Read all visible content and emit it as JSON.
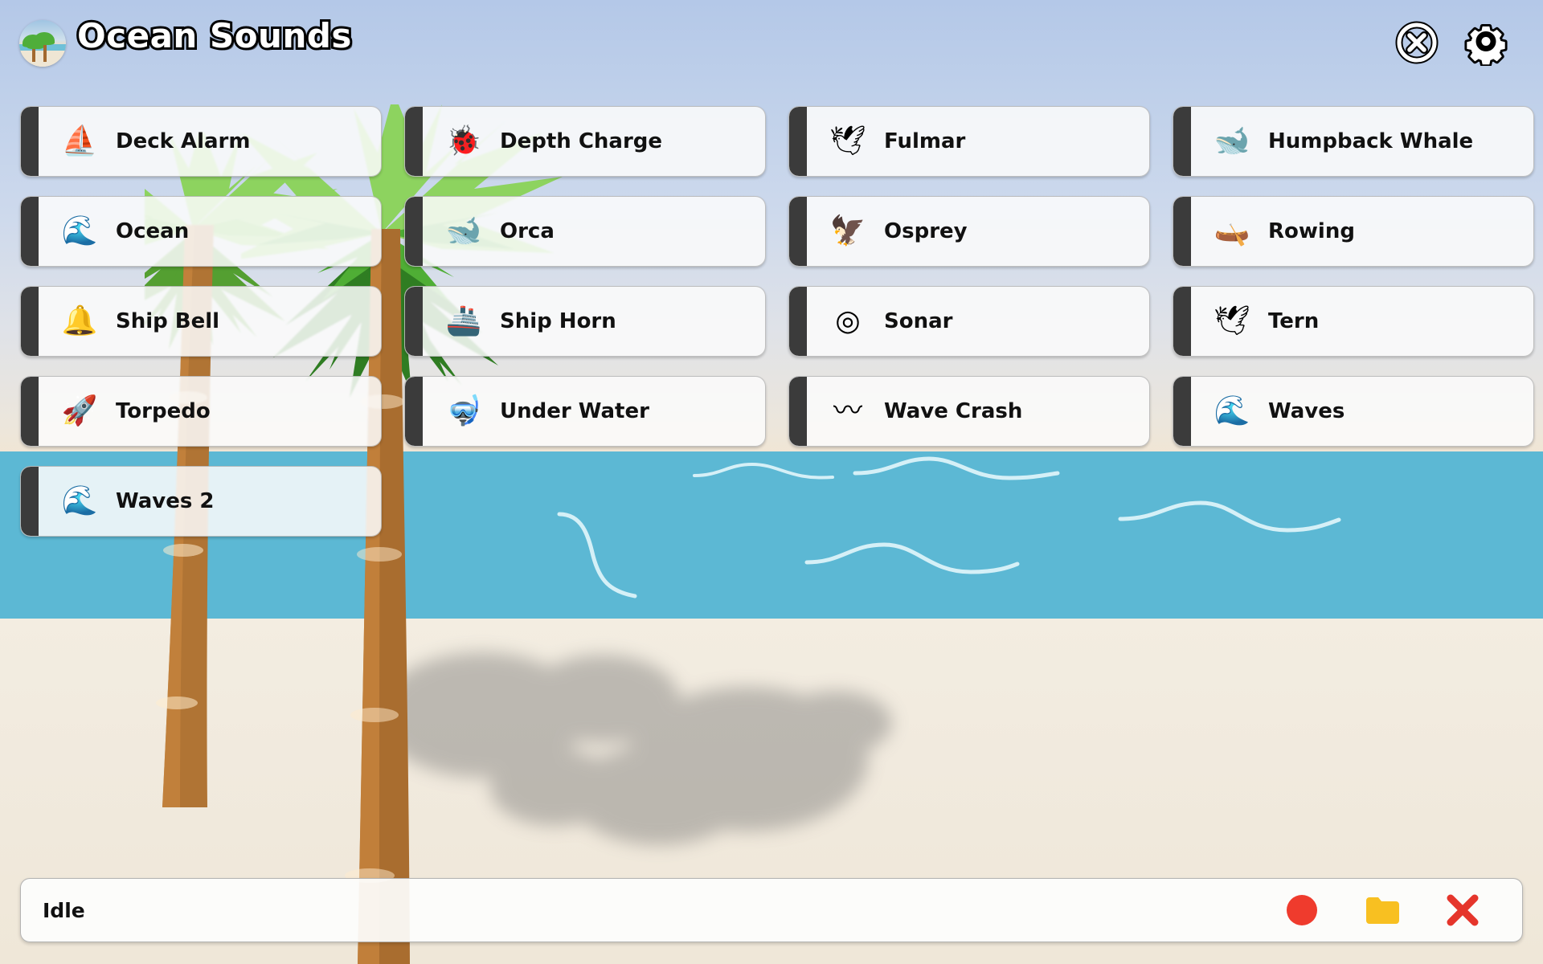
{
  "app": {
    "title": "Ocean Sounds",
    "logo_icon": "beach-palm-icon"
  },
  "header": {
    "stop_icon": "stop-circle-x-icon",
    "settings_icon": "gear-icon"
  },
  "colors": {
    "sky_top": "#b4c8e8",
    "sky_bottom": "#fde7c9",
    "ocean": "#5cb8d4",
    "sand": "#f2ece0",
    "button_tab": "#3b3b3b",
    "button_face": "#fcfcfc",
    "record_red": "#ef3b2d",
    "folder_yellow": "#f8c021",
    "close_red": "#e5352b"
  },
  "sounds": [
    {
      "label": "Deck Alarm",
      "icon": "⛵",
      "icon_name": "sailboat-icon"
    },
    {
      "label": "Depth Charge",
      "icon": "🐞",
      "icon_name": "naval-mine-icon"
    },
    {
      "label": "Fulmar",
      "icon": "🕊",
      "icon_name": "seagull-icon"
    },
    {
      "label": "Humpback Whale",
      "icon": "🐋",
      "icon_name": "whale-icon"
    },
    {
      "label": "Ocean",
      "icon": "🌊",
      "icon_name": "ocean-wave-icon"
    },
    {
      "label": "Orca",
      "icon": "🐋",
      "icon_name": "orca-icon"
    },
    {
      "label": "Osprey",
      "icon": "🦅",
      "icon_name": "eagle-icon"
    },
    {
      "label": "Rowing",
      "icon": "🛶",
      "icon_name": "kayak-icon"
    },
    {
      "label": "Ship Bell",
      "icon": "🔔",
      "icon_name": "bell-icon"
    },
    {
      "label": "Ship Horn",
      "icon": "🚢",
      "icon_name": "ship-icon"
    },
    {
      "label": "Sonar",
      "icon": "◎",
      "icon_name": "sonar-icon"
    },
    {
      "label": "Tern",
      "icon": "🕊",
      "icon_name": "tern-bird-icon"
    },
    {
      "label": "Torpedo",
      "icon": "🚀",
      "icon_name": "torpedo-icon"
    },
    {
      "label": "Under Water",
      "icon": "🤿",
      "icon_name": "diving-mask-icon"
    },
    {
      "label": "Wave Crash",
      "icon": "〰",
      "icon_name": "wave-crash-icon"
    },
    {
      "label": "Waves",
      "icon": "🌊",
      "icon_name": "waves-icon"
    },
    {
      "label": "Waves 2",
      "icon": "🌊",
      "icon_name": "waves-2-icon"
    }
  ],
  "statusbar": {
    "status": "Idle",
    "record_label": "record-button",
    "folder_label": "open-folder-button",
    "close_label": "close-button"
  }
}
